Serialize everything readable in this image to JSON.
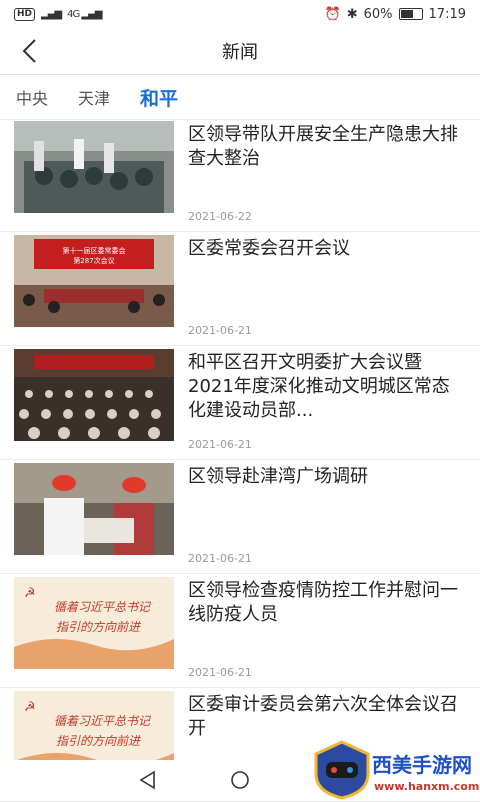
{
  "status": {
    "hd": "HD",
    "signal1": "▂▄▆",
    "signal2": "4G ▂▄▆",
    "battery": "60%",
    "time": "17:19"
  },
  "header": {
    "title": "新闻"
  },
  "tabs": [
    {
      "label": "中央"
    },
    {
      "label": "天津"
    },
    {
      "label": "和平"
    }
  ],
  "news": [
    {
      "title": "区领导带队开展安全生产隐患大排查大整治",
      "date": "2021-06-22"
    },
    {
      "title": "区委常委会召开会议",
      "date": "2021-06-21",
      "img_text": "第十一届区委常委会 第287次会议"
    },
    {
      "title": "和平区召开文明委扩大会议暨2021年度深化推动文明城区常态化建设动员部...",
      "date": "2021-06-21"
    },
    {
      "title": "区领导赴津湾广场调研",
      "date": "2021-06-21"
    },
    {
      "title": "区领导检查疫情防控工作并慰问一线防疫人员",
      "date": "2021-06-21",
      "img_text": "循着习近平总书记 指引的方向前进"
    },
    {
      "title": "区委审计委员会第六次全体会议召开",
      "date": "",
      "img_text": "循着习近平总书记 指引的方向前进"
    }
  ],
  "watermark": {
    "name": "西美手游网",
    "url": "www.hanxm.com"
  },
  "colors": {
    "accent": "#1a6fd6"
  }
}
